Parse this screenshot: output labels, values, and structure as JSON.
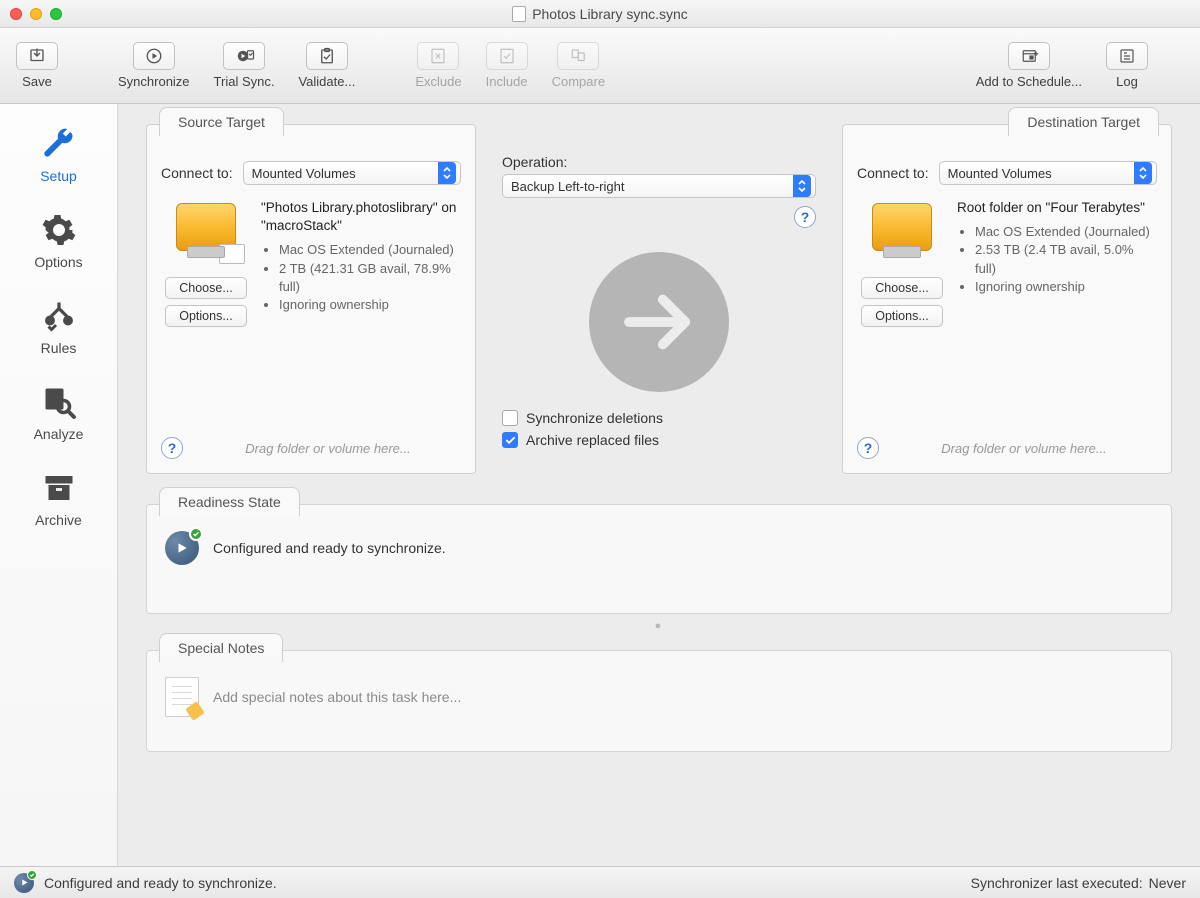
{
  "window": {
    "title": "Photos Library sync.sync"
  },
  "toolbar": {
    "save": "Save",
    "synchronize": "Synchronize",
    "trial": "Trial Sync.",
    "validate": "Validate...",
    "exclude": "Exclude",
    "include": "Include",
    "compare": "Compare",
    "schedule": "Add to Schedule...",
    "log": "Log"
  },
  "sidebar": {
    "setup": "Setup",
    "options": "Options",
    "rules": "Rules",
    "analyze": "Analyze",
    "archive": "Archive"
  },
  "source": {
    "tab": "Source Target",
    "connect_label": "Connect to:",
    "connect_value": "Mounted Volumes",
    "title": "\"Photos Library.photoslibrary\" on \"macroStack\"",
    "bullets": {
      "fs": "Mac OS Extended (Journaled)",
      "size": "2 TB (421.31 GB avail, 78.9% full)",
      "own": "Ignoring ownership"
    },
    "choose": "Choose...",
    "options": "Options...",
    "drag_hint": "Drag folder or volume here..."
  },
  "destination": {
    "tab": "Destination Target",
    "connect_label": "Connect to:",
    "connect_value": "Mounted Volumes",
    "title": "Root folder on \"Four Terabytes\"",
    "bullets": {
      "fs": "Mac OS Extended (Journaled)",
      "size": "2.53 TB (2.4 TB avail, 5.0% full)",
      "own": "Ignoring ownership"
    },
    "choose": "Choose...",
    "options": "Options...",
    "drag_hint": "Drag folder or volume here..."
  },
  "operation": {
    "label": "Operation:",
    "value": "Backup Left-to-right",
    "sync_deletions": {
      "label": "Synchronize deletions",
      "checked": false
    },
    "archive_replaced": {
      "label": "Archive replaced files",
      "checked": true
    }
  },
  "readiness": {
    "tab": "Readiness State",
    "text": "Configured and ready to synchronize."
  },
  "notes": {
    "tab": "Special Notes",
    "placeholder": "Add special notes about this task here..."
  },
  "statusbar": {
    "text": "Configured and ready to synchronize.",
    "last_label": "Synchronizer last executed:",
    "last_value": "Never"
  }
}
